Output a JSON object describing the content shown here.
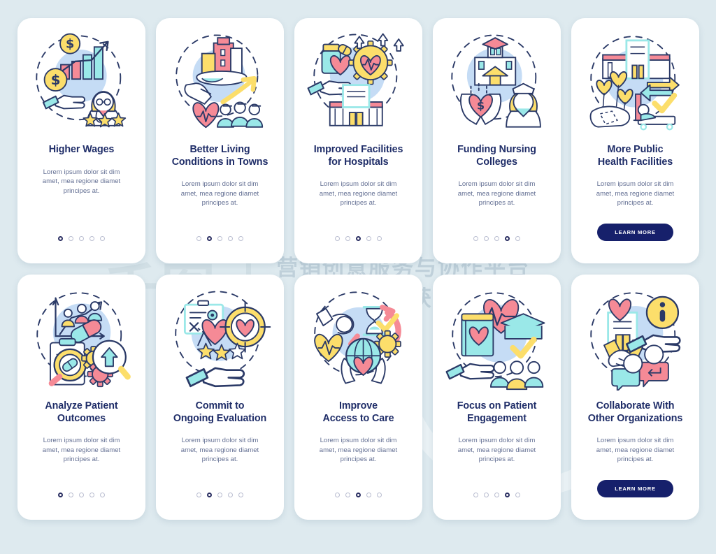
{
  "page": {
    "background_color": "#deeaef",
    "watermark": {
      "logo_text": "千图",
      "line1": "营销创意服务与协作平台",
      "line2": "商用请获取授权"
    }
  },
  "palette": {
    "title_color": "#1f2d68",
    "body_color": "#636f93",
    "outline": "#2b3a67",
    "yellow": "#fcde6b",
    "pink": "#f58a96",
    "cyan": "#9ae8e8",
    "blue_blob": "#c5dcf5",
    "button_navy": "#16206b",
    "dot_inactive": "#b9bdd0",
    "dot_active": "#2b2f62",
    "card_white": "#ffffff"
  },
  "common": {
    "body_text": "Lorem ipsum dolor sit dim\namet, mea regione diamet\nprincipes at.",
    "learn_more_label": "LEARN MORE",
    "dot_count": 5
  },
  "cards": [
    {
      "id": "higher-wages",
      "title": "Higher Wages",
      "body": "Lorem ipsum dolor sit dim\namet, mea regione diamet\nprincipes at.",
      "footer_type": "dots",
      "active_dot": 1,
      "illustration": "coins-chart-doctor-stars"
    },
    {
      "id": "better-living-conditions-in-towns",
      "title": "Better Living\nConditions in Towns",
      "body": "Lorem ipsum dolor sit dim\namet, mea regione diamet\nprincipes at.",
      "footer_type": "dots",
      "active_dot": 2,
      "illustration": "city-globe-heart-people-arrow"
    },
    {
      "id": "improved-facilities-for-hospitals",
      "title": "Improved Facilities\nfor Hospitals",
      "body": "Lorem ipsum dolor sit dim\namet, mea regione diamet\nprincipes at.",
      "footer_type": "dots",
      "active_dot": 3,
      "illustration": "medicine-hand-gear-heart-hospital"
    },
    {
      "id": "funding-nursing-colleges",
      "title": "Funding Nursing\nColleges",
      "body": "Lorem ipsum dolor sit dim\namet, mea regione diamet\nprincipes at.",
      "footer_type": "dots",
      "active_dot": 4,
      "illustration": "college-hands-heart-nurse"
    },
    {
      "id": "more-public-health-facilities",
      "title": "More Public\nHealth Facilities",
      "body": "Lorem ipsum dolor sit dim\namet, mea regione diamet\nprincipes at.",
      "footer_type": "button",
      "button_label": "LEARN MORE",
      "illustration": "clinic-balloons-bed-check"
    },
    {
      "id": "analyze-patient-outcomes",
      "title": "Analyze Patient\nOutcomes",
      "body": "Lorem ipsum dolor sit dim\namet, mea regione diamet\nprincipes at.",
      "footer_type": "dots",
      "active_dot": 1,
      "illustration": "graph-people-pills-clipboard-magnifier"
    },
    {
      "id": "commit-to-ongoing-evaluation",
      "title": "Commit to\nOngoing Evaluation",
      "body": "Lorem ipsum dolor sit dim\namet, mea regione diamet\nprincipes at.",
      "footer_type": "dots",
      "active_dot": 2,
      "illustration": "board-heart-target-stars-hand"
    },
    {
      "id": "improve-access-to-care",
      "title": "Improve\nAccess to Care",
      "body": "Lorem ipsum dolor sit dim\namet, mea regione diamet\nprincipes at.",
      "footer_type": "dots",
      "active_dot": 3,
      "illustration": "hourglass-cycle-check-gear-globe-hands"
    },
    {
      "id": "focus-on-patient-engagement",
      "title": "Focus on Patient\nEngagement",
      "body": "Lorem ipsum dolor sit dim\namet, mea regione diamet\nprincipes at.",
      "footer_type": "dots",
      "active_dot": 4,
      "illustration": "book-heartbeat-cap-check-people-hand"
    },
    {
      "id": "collaborate-with-other-organizations",
      "title": "Collaborate With\nOther Organizations",
      "body": "Lorem ipsum dolor sit dim\namet, mea regione diamet\nprincipes at.",
      "footer_type": "button",
      "button_label": "LEARN MORE",
      "illustration": "handshake-info-hand-chat-people"
    }
  ]
}
